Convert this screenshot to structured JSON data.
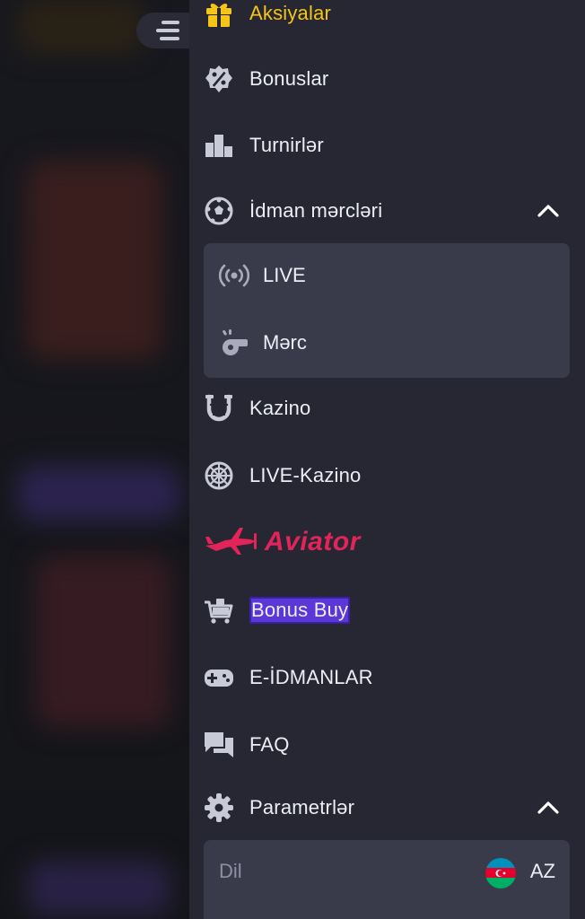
{
  "menu": {
    "items": [
      {
        "id": "aksiyalar",
        "label": "Aksiyalar",
        "icon": "gift-icon"
      },
      {
        "id": "bonuslar",
        "label": "Bonuslar",
        "icon": "percent-badge-icon"
      },
      {
        "id": "turnirler",
        "label": "Turnirlər",
        "icon": "podium-icon"
      },
      {
        "id": "idman",
        "label": "İdman mərcləri",
        "icon": "soccer-ball-icon"
      },
      {
        "id": "kazino",
        "label": "Kazino",
        "icon": "horseshoe-icon"
      },
      {
        "id": "live_kazino",
        "label": "LIVE-Kazino",
        "icon": "roulette-icon"
      },
      {
        "id": "aviator",
        "label": "Aviator",
        "icon": "aviator-plane-icon"
      },
      {
        "id": "bonus_buy",
        "label": "Bonus Buy",
        "icon": "shopping-cart-icon"
      },
      {
        "id": "eidman",
        "label": "E-İDMANLAR",
        "icon": "gamepad-icon"
      },
      {
        "id": "faq",
        "label": "FAQ",
        "icon": "chat-bubbles-icon"
      },
      {
        "id": "parametrler",
        "label": "Parametrlər",
        "icon": "gear-icon"
      }
    ],
    "sports_submenu": [
      {
        "id": "live",
        "label": "LIVE",
        "icon": "broadcast-icon"
      },
      {
        "id": "merc",
        "label": "Mərc",
        "icon": "whistle-icon"
      }
    ],
    "settings": {
      "language_label": "Dil",
      "language_code": "AZ",
      "flag_icon": "azerbaijan-flag-icon"
    }
  },
  "colors": {
    "accent_yellow": "#f5c518",
    "aviator_red": "#e3245a",
    "bonus_buy_highlight": "#5a37d6",
    "panel_bg": "#262732",
    "submenu_bg": "#3a3b4a",
    "text": "#eceef6",
    "icon": "#c9cad8"
  }
}
